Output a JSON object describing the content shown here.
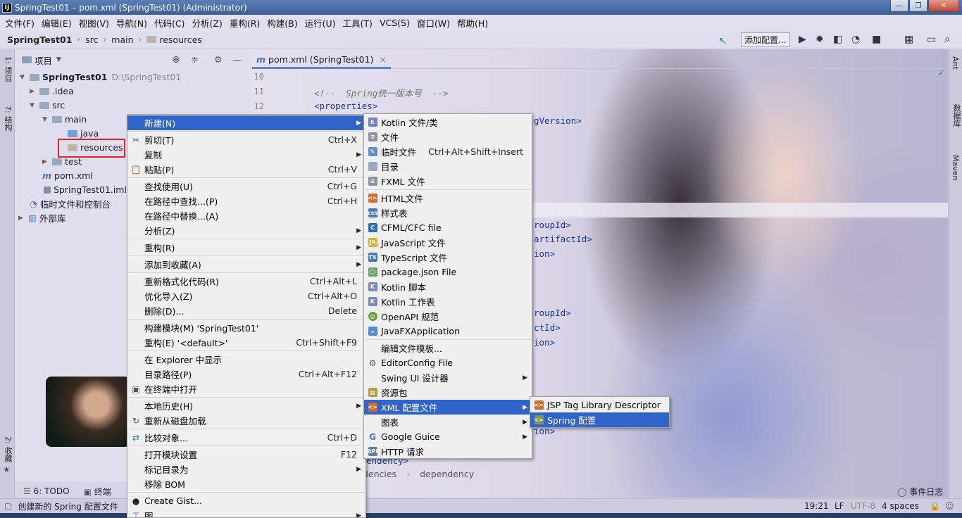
{
  "window": {
    "title": "SpringTest01 – pom.xml (SpringTest01) (Administrator)",
    "app_icon": "IJ",
    "buttons": [
      "—",
      "❐",
      "✕"
    ]
  },
  "menubar": [
    "文件(F)",
    "编辑(E)",
    "视图(V)",
    "导航(N)",
    "代码(C)",
    "分析(Z)",
    "重构(R)",
    "构建(B)",
    "运行(U)",
    "工具(T)",
    "VCS(S)",
    "窗口(W)",
    "帮助(H)"
  ],
  "navbar": {
    "project": "SpringTest01",
    "crumbs": [
      "src",
      "main",
      "resources"
    ],
    "run_config": "添加配置..."
  },
  "left_strip": {
    "project_tab": "1: 项目",
    "structure_tab": "7: 结构",
    "favorites_tab": "2: 收藏"
  },
  "right_strip": {
    "ant": "Ant",
    "database": "数据库",
    "maven": "Maven"
  },
  "project_panel": {
    "title": "项目",
    "tree": [
      {
        "label": "SpringTest01",
        "path": "D:\\SpringTest01"
      },
      {
        "label": ".idea"
      },
      {
        "label": "src"
      },
      {
        "label": "main"
      },
      {
        "label": "java"
      },
      {
        "label": "resources"
      },
      {
        "label": "test"
      },
      {
        "label": "pom.xml"
      },
      {
        "label": "SpringTest01.iml"
      },
      {
        "label": "临时文件和控制台"
      },
      {
        "label": "外部库"
      }
    ]
  },
  "editor": {
    "tab": "pom.xml (SpringTest01)",
    "line_numbers": [
      "10",
      "11",
      "12"
    ],
    "lines": {
      "comment": "<!--  Spring统一版本号  -->",
      "properties": "<properties>",
      "l1": "gVersion>",
      "l2": "roupId>",
      "l3": "artifactId>",
      "l4": "ion>",
      "l5": "roupId>",
      "l6": "ctId>",
      "l7": "ion>",
      "l8": "ion>",
      "l9": "endency>"
    },
    "breadcrumb": [
      "dencies",
      "dependency"
    ]
  },
  "context_menu": [
    {
      "label": "新建(N)",
      "sub": true,
      "selected": true
    },
    {
      "label": "剪切(T)",
      "shortcut": "Ctrl+X",
      "icon": "✂"
    },
    {
      "label": "复制",
      "sub": true
    },
    {
      "label": "粘贴(P)",
      "shortcut": "Ctrl+V",
      "icon": "📋"
    },
    {
      "label": "查找使用(U)",
      "shortcut": "Ctrl+G"
    },
    {
      "label": "在路径中查找...(P)",
      "shortcut": "Ctrl+H"
    },
    {
      "label": "在路径中替换...(A)"
    },
    {
      "label": "分析(Z)",
      "sub": true
    },
    {
      "label": "重构(R)",
      "sub": true
    },
    {
      "label": "添加到收藏(A)",
      "sub": true
    },
    {
      "label": "重新格式化代码(R)",
      "shortcut": "Ctrl+Alt+L"
    },
    {
      "label": "优化导入(Z)",
      "shortcut": "Ctrl+Alt+O"
    },
    {
      "label": "删除(D)...",
      "shortcut": "Delete"
    },
    {
      "label": "构建模块(M) 'SpringTest01'"
    },
    {
      "label": "重构(E) '<default>'",
      "shortcut": "Ctrl+Shift+F9"
    },
    {
      "label": "在 Explorer 中显示"
    },
    {
      "label": "目录路径(P)",
      "shortcut": "Ctrl+Alt+F12"
    },
    {
      "label": "在终端中打开",
      "icon": "▣"
    },
    {
      "label": "本地历史(H)",
      "sub": true
    },
    {
      "label": "重新从磁盘加载",
      "icon": "↻"
    },
    {
      "label": "比较对象...",
      "shortcut": "Ctrl+D",
      "icon": "⇄"
    },
    {
      "label": "打开模块设置",
      "shortcut": "F12"
    },
    {
      "label": "标记目录为",
      "sub": true
    },
    {
      "label": "移除 BOM"
    },
    {
      "label": "Create Gist...",
      "icon": "●"
    },
    {
      "label": "图",
      "sub": true
    }
  ],
  "new_menu": [
    {
      "label": "Kotlin 文件/类",
      "icon_color": "#6c7fd8"
    },
    {
      "label": "文件",
      "icon_color": "#8a94a6"
    },
    {
      "label": "临时文件",
      "shortcut": "Ctrl+Alt+Shift+Insert",
      "icon_color": "#6a8fc4"
    },
    {
      "label": "目录",
      "icon_color": "#9aa9bd"
    },
    {
      "label": "FXML 文件",
      "icon_color": "#8a94a6"
    },
    {
      "label": "HTML文件",
      "icon_color": "#d46a2a"
    },
    {
      "label": "样式表",
      "icon_color": "#4a76c2"
    },
    {
      "label": "CFML/CFC file",
      "icon_color": "#2c6fb6"
    },
    {
      "label": "JavaScript 文件",
      "icon_color": "#d9b62d"
    },
    {
      "label": "TypeScript 文件",
      "icon_color": "#3a7dc4"
    },
    {
      "label": "package.json File",
      "icon_color": "#6aa86a"
    },
    {
      "label": "Kotlin 脚本",
      "icon_color": "#7c8ac4"
    },
    {
      "label": "Kotlin 工作表",
      "icon_color": "#7c8ac4"
    },
    {
      "label": "OpenAPI 规范",
      "icon_color": "#6aa03a"
    },
    {
      "label": "JavaFXApplication",
      "icon_color": "#4a8fd0"
    },
    {
      "label": "编辑文件模板..."
    },
    {
      "label": "EditorConfig File",
      "icon_color": "#888888"
    },
    {
      "label": "Swing UI 设计器",
      "sub": true
    },
    {
      "label": "资源包",
      "icon_color": "#b99a40"
    },
    {
      "label": "XML 配置文件",
      "sub": true,
      "selected": true,
      "icon_color": "#d46a2a"
    },
    {
      "label": "图表",
      "sub": true
    },
    {
      "label": "Google Guice",
      "sub": true,
      "icon_color": "#3a78d8"
    },
    {
      "label": "HTTP 请求",
      "icon_color": "#5a7fb0"
    }
  ],
  "xml_menu": [
    {
      "label": "JSP Tag Library Descriptor"
    },
    {
      "label": "Spring 配置",
      "selected": true
    }
  ],
  "tool_tabs": [
    "6: TODO",
    "终端",
    "事件日志"
  ],
  "status": {
    "message": "创建新的 Spring 配置文件",
    "position": "19:21",
    "line_sep": "LF",
    "encoding": "UTF-8",
    "indent": "4 spaces"
  },
  "colors": {
    "selection": "#2f65ca",
    "menu_bg": "#f0f0f0",
    "highlight_box": "#e02424",
    "xml_tag": "#1a34a0"
  }
}
